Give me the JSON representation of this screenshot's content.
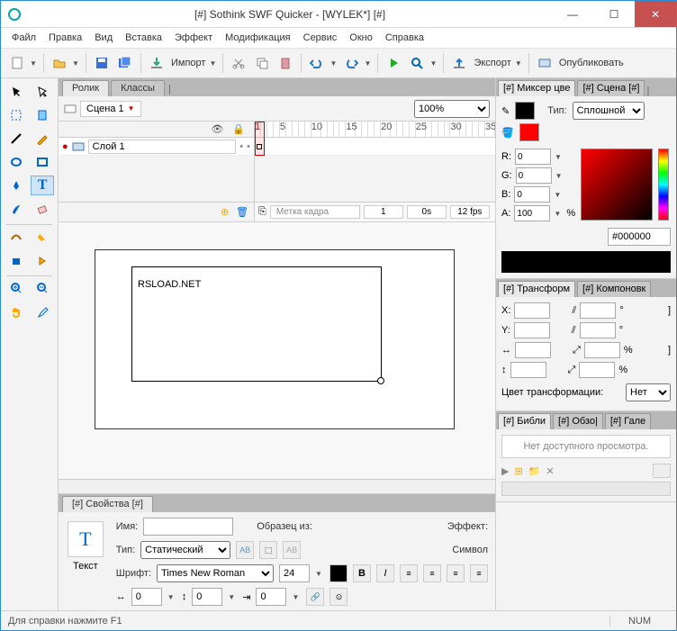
{
  "window": {
    "title": "[#] Sothink SWF Quicker - [WYLEK*] [#]"
  },
  "menu": {
    "file": "Файл",
    "edit": "Правка",
    "view": "Вид",
    "insert": "Вставка",
    "effect": "Эффект",
    "modify": "Модификация",
    "service": "Сервис",
    "window": "Окно",
    "help": "Справка"
  },
  "toolbar": {
    "import": "Импорт",
    "export": "Экспорт",
    "publish": "Опубликовать"
  },
  "timeline": {
    "tabs": {
      "movie": "Ролик",
      "classes": "Классы"
    },
    "scene": "Сцена 1",
    "zoom": "100%",
    "layer": "Слой 1",
    "frame_label": "Метка кадра",
    "frame_num": "1",
    "time": "0s",
    "fps": "12 fps",
    "ticks": [
      "1",
      "5",
      "10",
      "15",
      "20",
      "25",
      "30",
      "35"
    ]
  },
  "canvas": {
    "text": "RSLOAD.NET"
  },
  "props": {
    "tab": "[#] Свойства [#]",
    "object": "Текст",
    "name_lbl": "Имя:",
    "sample_lbl": "Образец из:",
    "effect_lbl": "Эффект:",
    "type_lbl": "Тип:",
    "type_val": "Статический",
    "symbol_lbl": "Символ",
    "font_lbl": "Шрифт:",
    "font_val": "Times New Roman",
    "font_size": "24",
    "spacing": "0",
    "leading": "0",
    "indent": "0"
  },
  "mixer": {
    "tabs": {
      "mixer": "[#] Миксер цве",
      "scene": "[#] Сцена [#]"
    },
    "type_lbl": "Тип:",
    "type_val": "Сплошной",
    "r": "R:",
    "g": "G:",
    "b": "B:",
    "a": "A:",
    "rv": "0",
    "gv": "0",
    "bv": "0",
    "av": "100",
    "pct": "%",
    "hex": "#000000"
  },
  "transform": {
    "tabs": {
      "t": "[#] Трансформ",
      "c": "[#] Компоновк"
    },
    "x": "X:",
    "y": "Y:",
    "color_lbl": "Цвет трансформации:",
    "color_val": "Нет"
  },
  "library": {
    "tabs": {
      "lib": "[#] Библи",
      "review": "[#] Обзо|",
      "gallery": "[#] Гале"
    },
    "empty": "Нет доступного просмотра."
  },
  "status": {
    "help": "Для справки нажмите F1",
    "num": "NUM"
  }
}
